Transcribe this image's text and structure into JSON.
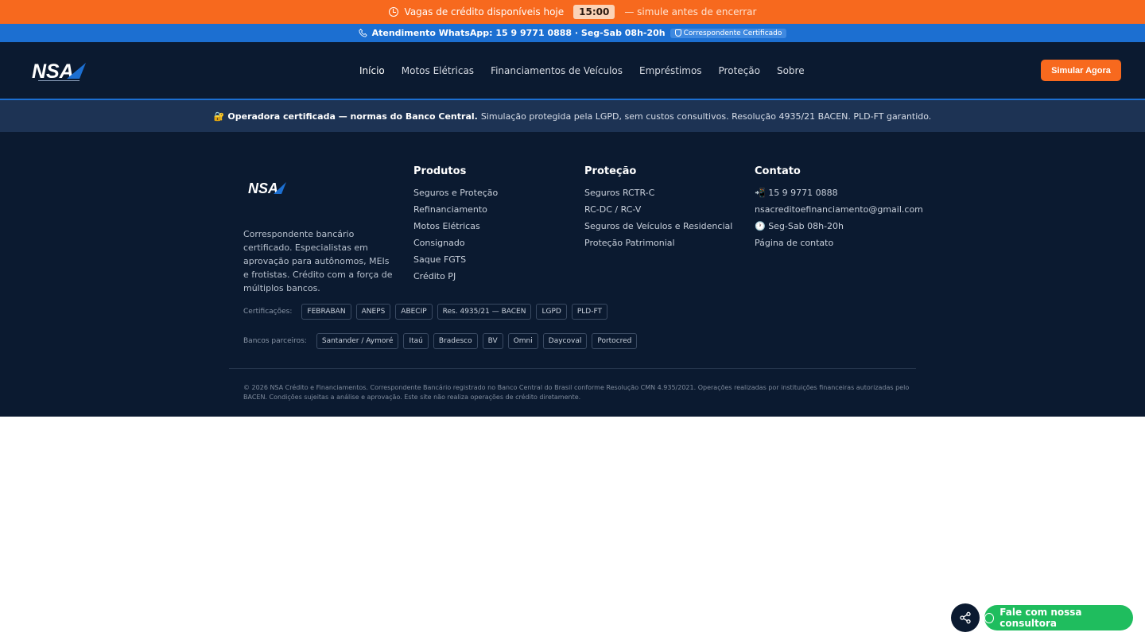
{
  "topbar": {
    "text": "Vagas de crédito disponíveis hoje",
    "timer": "15:00",
    "suffix": "— simule antes de encerrar"
  },
  "bluebar": {
    "text": "Atendimento WhatsApp: 15 9 9771 0888 · Seg-Sab 08h-20h",
    "badge": "Correspondente Certificado"
  },
  "brand": {
    "logo_text": "NSA",
    "accent": "#f7691e",
    "blue": "#1c6fd1",
    "navy": "#0b1a30"
  },
  "nav": {
    "items": [
      "Início",
      "Motos Elétricas",
      "Financiamentos de Veículos",
      "Empréstimos",
      "Proteção",
      "Sobre"
    ],
    "cta": "Simular Agora"
  },
  "certbar": {
    "icon": "🔐",
    "bold": "Operadora certificada — normas do Banco Central.",
    "text": "Simulação protegida pela LGPD, sem custos consultivos. Resolução 4935/21 BACEN. PLD-FT garantido."
  },
  "footer": {
    "description": "Correspondente bancário certificado. Especialistas em aprovação para autônomos, MEIs e frotistas. Crédito com a força de múltiplos bancos.",
    "produtos": {
      "title": "Produtos",
      "items": [
        "Seguros e Proteção",
        "Refinanciamento",
        "Motos Elétricas",
        "Consignado",
        "Saque FGTS",
        "Crédito PJ"
      ]
    },
    "protecao": {
      "title": "Proteção",
      "items": [
        "Seguros RCTR-C",
        "RC-DC / RC-V",
        "Seguros de Veículos e Residencial",
        "Proteção Patrimonial"
      ]
    },
    "contato": {
      "title": "Contato",
      "items": [
        "📲 15 9 9771 0888",
        "nsacreditoefinanciamento@gmail.com",
        "🕐 Seg-Sab 08h-20h",
        "Página de contato"
      ]
    },
    "certificacoes": {
      "label": "Certificações:",
      "tags": [
        "FEBRABAN",
        "ANEPS",
        "ABECIP",
        "Res. 4935/21 — BACEN",
        "LGPD",
        "PLD-FT"
      ]
    },
    "bancos": {
      "label": "Bancos parceiros:",
      "tags": [
        "Santander / Aymoré",
        "Itaú",
        "Bradesco",
        "BV",
        "Omni",
        "Daycoval",
        "Portocred"
      ]
    },
    "legal": "© 2026 NSA Crédito e Financiamentos. Correspondente Bancário registrado no Banco Central do Brasil conforme Resolução CMN 4.935/2021. Operações realizadas por instituições financeiras autorizadas pelo BACEN. Condições sujeitas a análise e aprovação. Este site não realiza operações de crédito diretamente."
  },
  "floating": {
    "whatsapp": "Fale com nossa consultora",
    "share_icon": "share-icon",
    "whatsapp_icon": "whatsapp-icon"
  }
}
